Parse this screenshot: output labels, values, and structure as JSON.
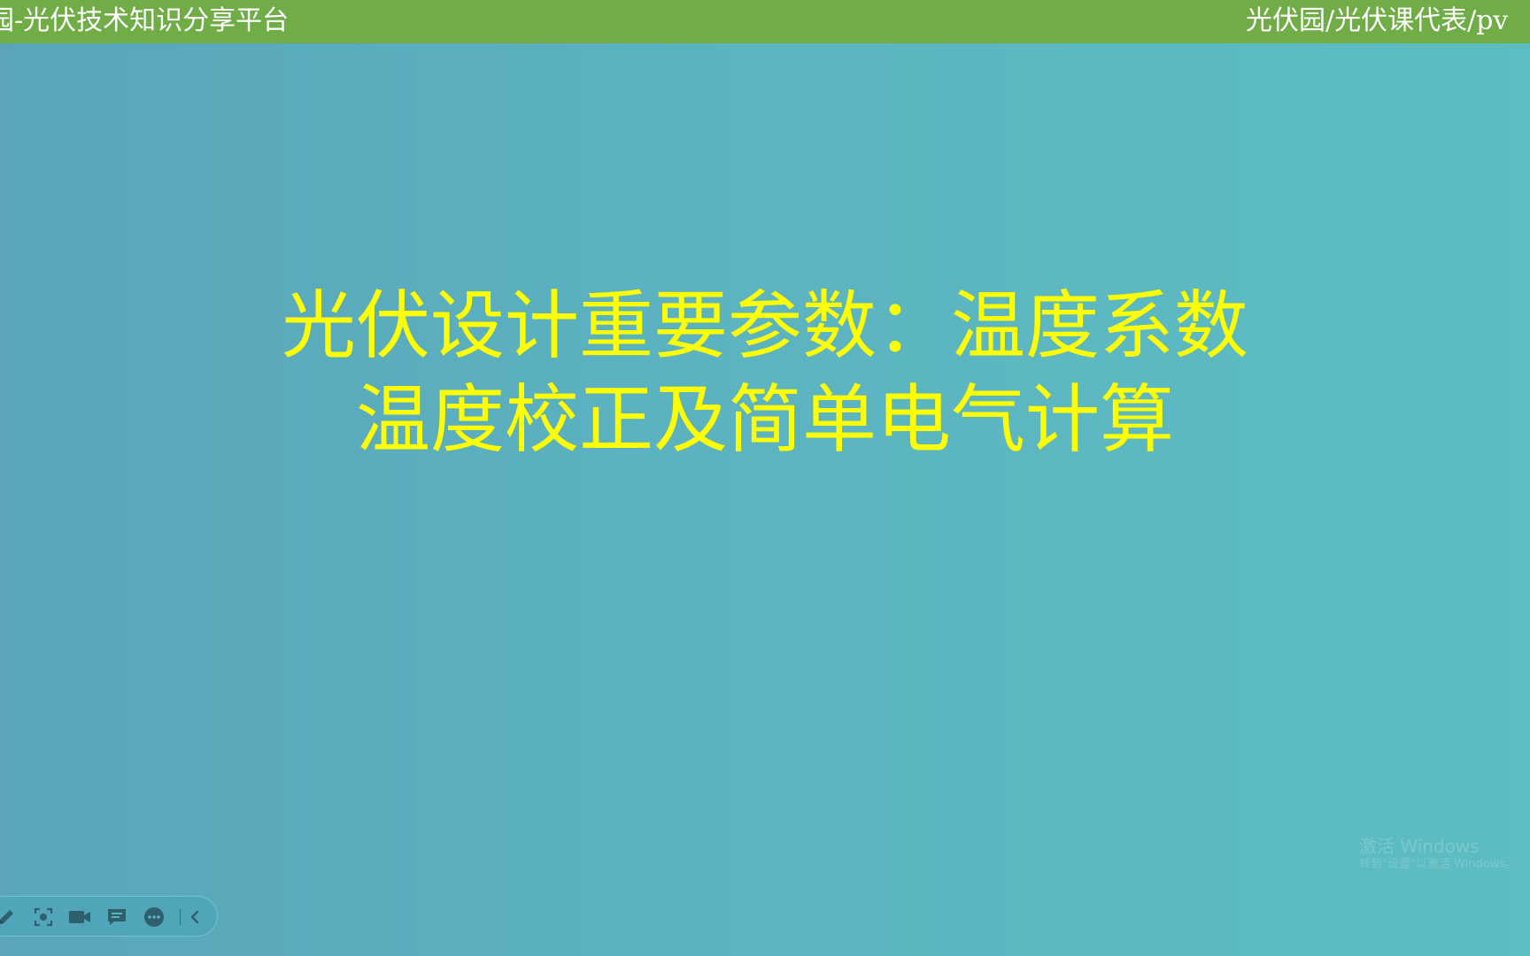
{
  "header": {
    "left_text": "园-光伏技术知识分享平台",
    "right_text": "光伏园/光伏课代表/pv"
  },
  "slide": {
    "title_line1": "光伏设计重要参数：温度系数",
    "title_line2": "温度校正及简单电气计算"
  },
  "watermark": {
    "line1": "激活 Windows",
    "line2": "转到\"设置\"以激活 Windows。"
  },
  "toolbar": {
    "icons": [
      "pen-icon",
      "screenshot-icon",
      "video-camera-icon",
      "comment-icon",
      "more-icon",
      "chevron-left-icon"
    ]
  },
  "colors": {
    "header_bg": "#70ad47",
    "title": "#ffff00",
    "background": "#5bb3c0"
  }
}
